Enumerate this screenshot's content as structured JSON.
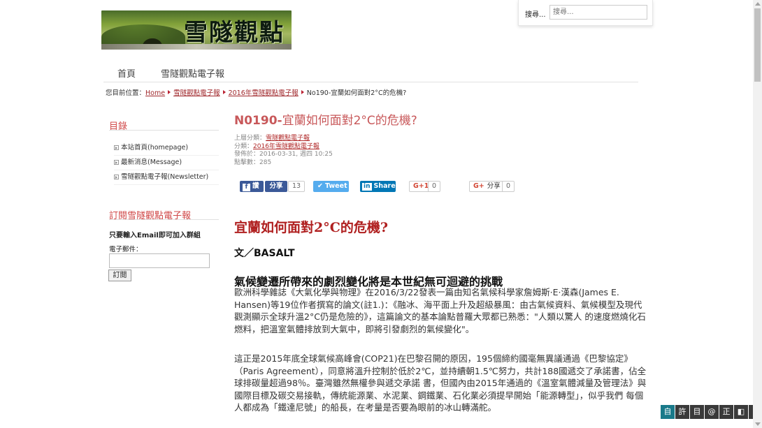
{
  "header": {
    "logo_text": "雪隧觀點",
    "search_label": "搜尋...",
    "search_placeholder": "搜尋..."
  },
  "nav": {
    "items": [
      "首頁",
      "雪隧觀點電子報"
    ]
  },
  "breadcrumb": {
    "prefix": "您目前位置：",
    "links": [
      "Home",
      "雪隧觀點電子報",
      "2016年雪隧觀點電子報"
    ],
    "current": "No190-宜蘭如何面對2°C的危機?"
  },
  "sidebar": {
    "menu_title": "目錄",
    "menu_items": [
      "本站首頁(homepage)",
      "最新消息(Message)",
      "雪隧觀點電子報(Newsletter)"
    ],
    "subscribe_title": "訂閱雪隧觀點電子報",
    "subscribe_note": "只要輸入Email即可加入群組",
    "email_label": "電子郵件：",
    "subscribe_button": "訂閱"
  },
  "article": {
    "title_prefix": "N0190-",
    "title_main": "宜蘭如何面對2°C的危機?",
    "meta": {
      "parent_label": "上層分類：",
      "parent_link": "雪隧觀點電子報",
      "category_label": "分類：",
      "category_link": "2016年雪隧觀點電子報",
      "published": "發佈於：2016-03-31, 週四 10:25",
      "hits": "點擊數：285"
    },
    "share": {
      "fb_like": "讚",
      "fb_share": "分享",
      "fb_count": "13",
      "tweet": "Tweet",
      "linkedin": "Share",
      "gplus_one": "G+1",
      "gplus_count": "0",
      "gplus_share": "分享",
      "gshare_count": "0"
    },
    "heading": "宜蘭如何面對2°C的危機?",
    "byline": "文／BASALT",
    "subheading": "氣候變遷所帶來的劇烈變化將是本世紀無可迴避的挑戰",
    "paragraph1": "歐洲科學雜誌《大氣化學與物理》在2016/3/22發表一篇由知名氣候科學家詹姆斯·E·漢森(James E. Hansen)等19位作者撰寫的論文(註1.)：《融冰、海平面上升及超級暴風：由古氣候資料、氣候模型及現代觀測顯示全球升溫2°C仍是危險的》，這篇論文的基本論點普羅大眾都已熟悉：\"人類以驚人 的速度燃燒化石燃料，把溫室氣體排放到大氣中，即將引發劇烈的氣候變化\"。",
    "paragraph2": "這正是2015年底全球氣候高峰會(COP21)在巴黎召開的原因，195個締約國毫無異議通過《巴黎協定》（Paris Agreement），同意將溫升控制於低於2℃，並持續朝1.5℃努力，共計188國遞交了承諾書，佔全球排碳量超過98％。臺灣雖然無權參與遞交承諾 書，但國內由2015年通過的《溫室氣體減量及管理法》與國際目標及碳交易接軌，傳統能源業、水泥業、鋼鐵業、石化業必須提早開始「能源轉型」，似乎我們 每個人都成為「鐵達尼號」的船長，在考量是否要為眼前的冰山轉滿舵。"
  },
  "toolbar": {
    "buttons": [
      "自",
      "許",
      "目",
      "@",
      "正",
      "◧",
      "⚙"
    ]
  },
  "colors": {
    "accent": "#c8585a",
    "link": "#a0282c",
    "facebook": "#3b5998",
    "twitter": "#55acee",
    "linkedin": "#0077b5"
  }
}
